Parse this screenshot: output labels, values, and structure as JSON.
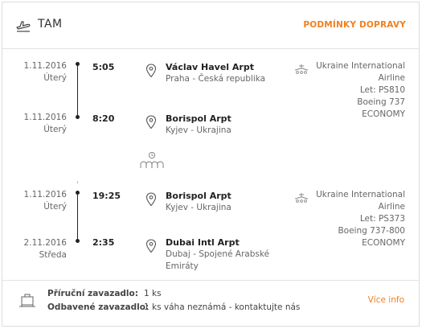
{
  "header": {
    "title": "TAM",
    "conditions_link": "PODMÍNKY DOPRAVY"
  },
  "segments": [
    {
      "departure": {
        "date": "1.11.2016",
        "weekday": "Úterý",
        "time": "5:05",
        "airport": "Václav Havel Arpt",
        "place": "Praha - Česká republika"
      },
      "arrival": {
        "date": "1.11.2016",
        "weekday": "Úterý",
        "time": "8:20",
        "airport": "Borispol Arpt",
        "place": "Kyjev - Ukrajina"
      },
      "airline": {
        "name_line1": "Ukraine International",
        "name_line2": "Airline",
        "flight": "Let: PS810",
        "aircraft": "Boeing 737",
        "cabin": "ECONOMY"
      }
    },
    {
      "departure": {
        "date": "1.11.2016",
        "weekday": "Úterý",
        "time": "19:25",
        "airport": "Borispol Arpt",
        "place": "Kyjev - Ukrajina"
      },
      "arrival": {
        "date": "2.11.2016",
        "weekday": "Středa",
        "time": "2:35",
        "airport": "Dubai Intl Arpt",
        "place_line1": "Dubaj - Spojené Arabské",
        "place_line2": "Emiráty"
      },
      "airline": {
        "name_line1": "Ukraine International",
        "name_line2": "Airline",
        "flight": "Let: PS373",
        "aircraft": "Boeing 737-800",
        "cabin": "ECONOMY"
      }
    }
  ],
  "baggage": {
    "hand_label": "Příruční zavazadlo:",
    "hand_value": "1 ks",
    "checked_label": "Odbavené zavazadlo:",
    "checked_value": "1 ks váha neznámá - kontaktujte nás",
    "more_link": "Více info"
  },
  "colors": {
    "accent": "#f08020",
    "text": "#333333",
    "muted": "#666666",
    "border": "#e2e2e2"
  },
  "icons": {
    "header": "airplane-takeoff-icon",
    "pin": "location-pin-icon",
    "airline": "airline-logo-icon",
    "layover": "layover-waiting-icon",
    "baggage": "luggage-icon"
  }
}
